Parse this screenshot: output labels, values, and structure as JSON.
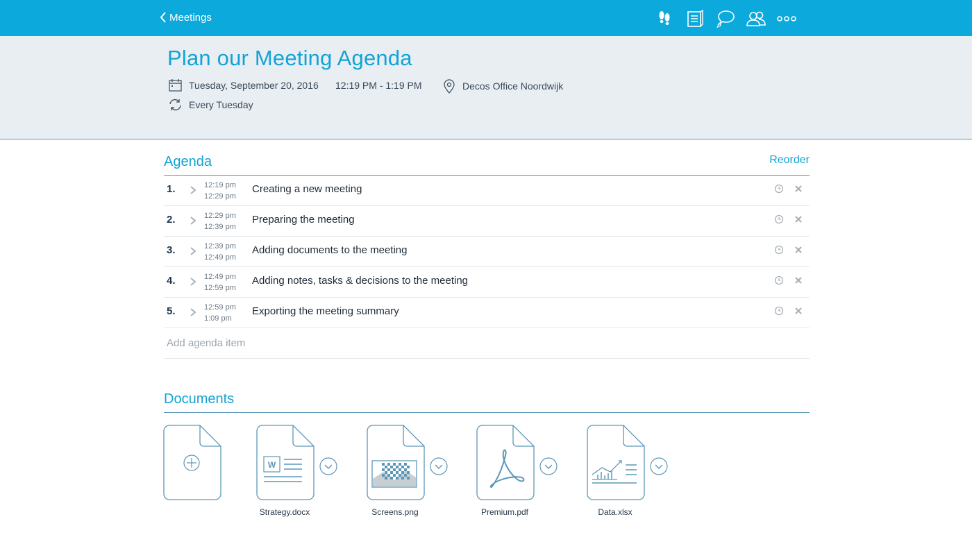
{
  "nav": {
    "back_label": "Meetings",
    "icons": [
      "footsteps-icon",
      "notes-icon",
      "chat-icon",
      "people-icon",
      "more-icon"
    ]
  },
  "meeting": {
    "title": "Plan our Meeting Agenda",
    "date": "Tuesday, September 20, 2016",
    "time": "12:19 PM - 1:19 PM",
    "location": "Decos Office Noordwijk",
    "recurrence": "Every Tuesday"
  },
  "agenda": {
    "title": "Agenda",
    "reorder_label": "Reorder",
    "add_placeholder": "Add agenda item",
    "items": [
      {
        "num": "1.",
        "start": "12:19 pm",
        "end": "12:29 pm",
        "label": "Creating a new meeting"
      },
      {
        "num": "2.",
        "start": "12:29 pm",
        "end": "12:39 pm",
        "label": "Preparing the meeting"
      },
      {
        "num": "3.",
        "start": "12:39 pm",
        "end": "12:49 pm",
        "label": "Adding documents to the meeting"
      },
      {
        "num": "4.",
        "start": "12:49 pm",
        "end": "12:59 pm",
        "label": "Adding notes, tasks & decisions to the meeting"
      },
      {
        "num": "5.",
        "start": "12:59 pm",
        "end": "1:09 pm",
        "label": "Exporting the meeting summary"
      }
    ]
  },
  "documents": {
    "title": "Documents",
    "files": [
      {
        "name": "Strategy.docx",
        "icon": "word-document-icon"
      },
      {
        "name": "Screens.png",
        "icon": "image-document-icon"
      },
      {
        "name": "Premium.pdf",
        "icon": "pdf-document-icon"
      },
      {
        "name": "Data.xlsx",
        "icon": "spreadsheet-document-icon"
      }
    ]
  },
  "colors": {
    "brand": "#0ca9dc",
    "accent_text": "#12a3d6",
    "header_bg": "#e8eef2",
    "icon_stroke": "#5d97b8"
  }
}
